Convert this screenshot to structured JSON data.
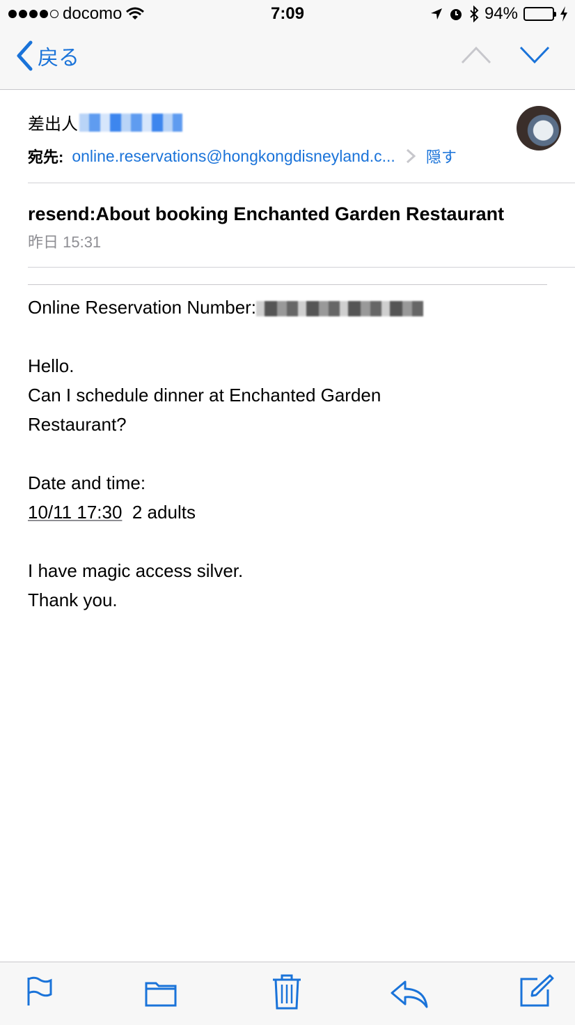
{
  "status_bar": {
    "carrier": "docomo",
    "time": "7:09",
    "battery": "94%"
  },
  "nav": {
    "back_label": "戻る"
  },
  "header": {
    "from_label": "差出人",
    "to_label": "宛先:",
    "to_address": "online.reservations@hongkongdisneyland.c...",
    "hide_label": "隠す",
    "subject": "resend:About booking Enchanted Garden Restaurant",
    "date": "昨日 15:31"
  },
  "body": {
    "reservation_label": "Online Reservation Number:",
    "greeting": "Hello.",
    "question_line1": "Can I schedule dinner at Enchanted Garden",
    "question_line2": "Restaurant?",
    "date_time_label": "Date and time:",
    "date_time_value": "10/11 17:30",
    "party": "2 adults",
    "note": "I have magic access silver.",
    "thanks": "Thank you."
  },
  "colors": {
    "accent": "#1a73d9",
    "battery": "#4cd964"
  },
  "toolbar": {
    "icons": [
      "flag-icon",
      "folder-icon",
      "trash-icon",
      "reply-icon",
      "compose-icon"
    ]
  }
}
